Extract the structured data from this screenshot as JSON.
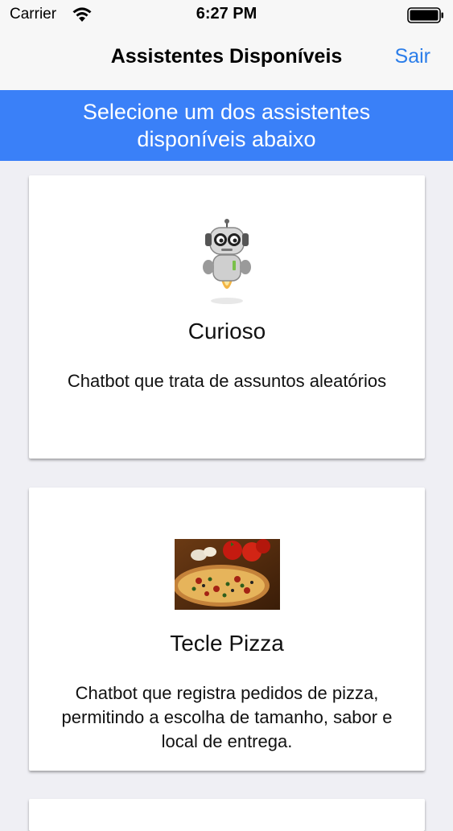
{
  "status_bar": {
    "carrier": "Carrier",
    "time": "6:27 PM"
  },
  "nav": {
    "title": "Assistentes Disponíveis",
    "logout_label": "Sair"
  },
  "banner": {
    "text": "Selecione um dos assistentes disponíveis abaixo"
  },
  "assistants": [
    {
      "name": "Curioso",
      "description": "Chatbot que trata de assuntos aleatórios",
      "image_icon": "robot-mascot-image"
    },
    {
      "name": "Tecle Pizza",
      "description": "Chatbot que registra pedidos de pizza, permitindo a escolha de tamanho, sabor e local de entrega.",
      "image_icon": "pizza-photo-image"
    }
  ],
  "colors": {
    "accent": "#2b7de9",
    "banner": "#3a80f8",
    "background": "#efeff4"
  }
}
